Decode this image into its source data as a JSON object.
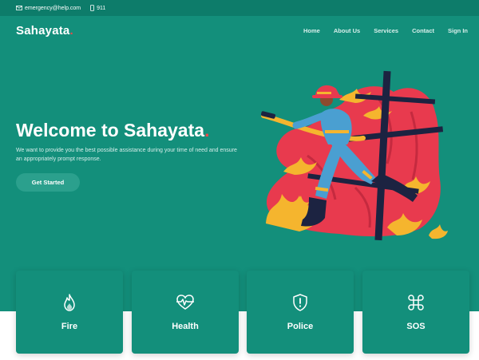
{
  "topbar": {
    "email": "emergency@help.com",
    "phone": "911"
  },
  "brand": {
    "name": "Sahayata",
    "dot": "."
  },
  "nav": {
    "items": [
      "Home",
      "About Us",
      "Services",
      "Contact",
      "Sign In"
    ]
  },
  "hero": {
    "title": "Welcome to Sahayata",
    "title_dot": ".",
    "subtitle": "We want to provide you the best possible assistance during your time of need and ensure an appropriately prompt response.",
    "cta_label": "Get Started",
    "illustration": "firefighter-illustration"
  },
  "services": [
    {
      "label": "Fire",
      "icon": "flame-icon"
    },
    {
      "label": "Health",
      "icon": "heart-pulse-icon"
    },
    {
      "label": "Police",
      "icon": "shield-alert-icon"
    },
    {
      "label": "SOS",
      "icon": "command-icon"
    }
  ],
  "colors": {
    "primary": "#138f7b",
    "topbar": "#0d7c6a",
    "accent_dot": "#e84a4a",
    "button": "#2ba08d"
  }
}
